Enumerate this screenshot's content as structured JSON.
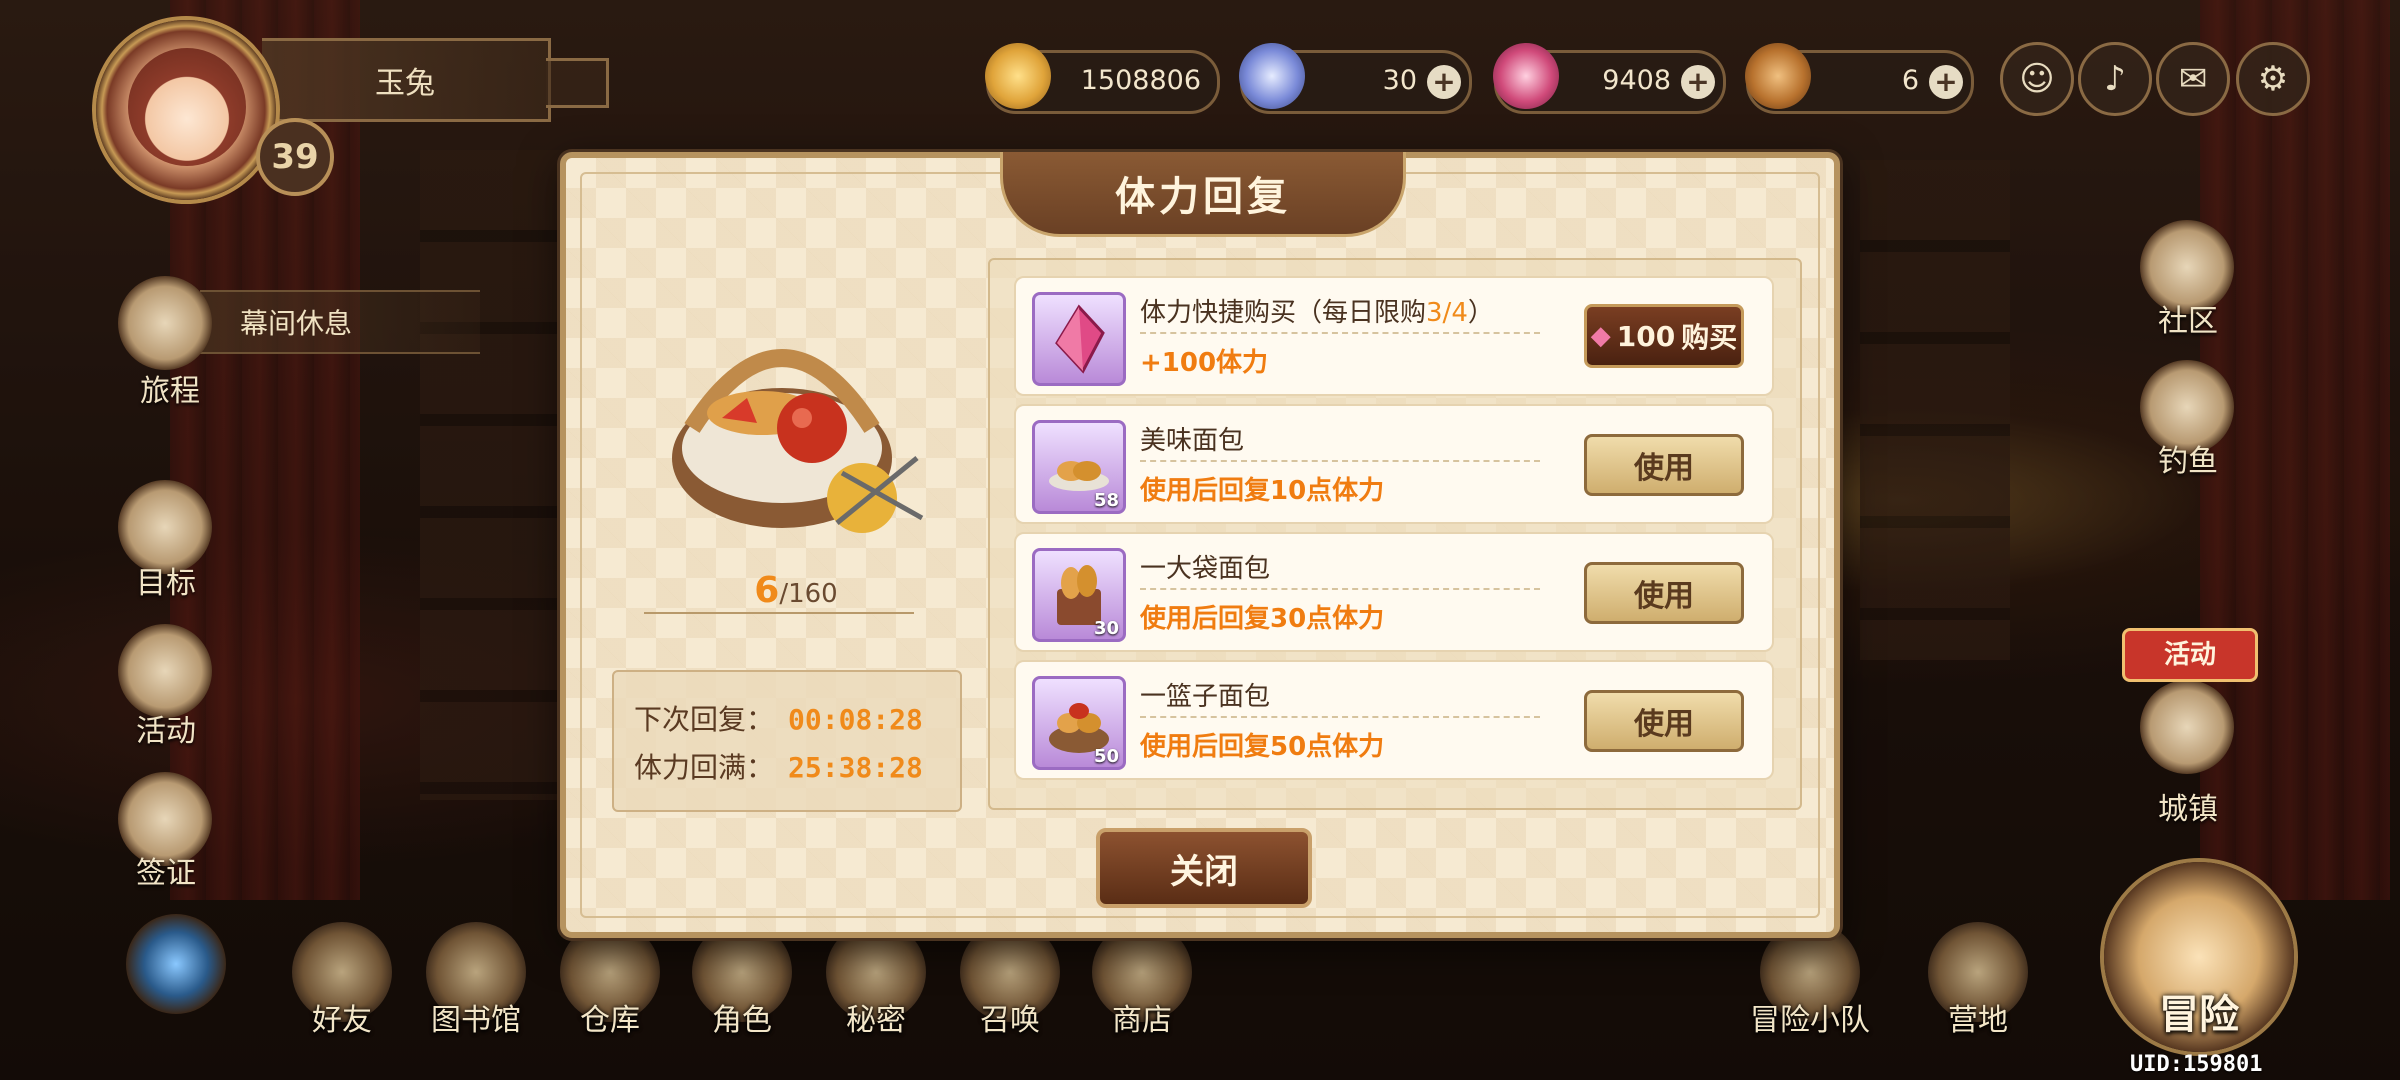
{
  "player": {
    "name": "玉兔",
    "level": "39"
  },
  "currencies": [
    {
      "id": "gold",
      "value": "1508806",
      "has_plus": false,
      "color": "#e0a43a"
    },
    {
      "id": "diamond",
      "value": "30",
      "has_plus": true,
      "color": "#7a8ad8"
    },
    {
      "id": "crystal",
      "value": "9408",
      "has_plus": true,
      "color": "#d04a7a"
    },
    {
      "id": "bread",
      "value": "6",
      "has_plus": true,
      "color": "#b8722e"
    }
  ],
  "plus_glyph": "+",
  "left_nav": {
    "journey": "旅程",
    "journey_plate": "幕间休息",
    "goal": "目标",
    "activity": "活动",
    "passport": "签证"
  },
  "right_nav": {
    "community": "社区",
    "fishing": "钓鱼",
    "event_badge": "活动",
    "town": "城镇"
  },
  "bottom_nav": [
    "好友",
    "图书馆",
    "仓库",
    "角色",
    "秘密",
    "召唤",
    "商店",
    "冒险小队",
    "营地"
  ],
  "adventure": "冒险",
  "uid": "UID:159801",
  "modal": {
    "title": "体力回复",
    "stamina_current": "6",
    "stamina_max": "/160",
    "next_recover_label": "下次回复：",
    "next_recover_time": "00:08:28",
    "full_recover_label": "体力回满：",
    "full_recover_time": "25:38:28",
    "quick_buy": {
      "name_prefix": "体力快捷购买（每日限购",
      "limit": "3/4",
      "name_suffix": "）",
      "desc": "+100体力",
      "price": "100",
      "buy_label": "购买"
    },
    "items": [
      {
        "name": "美味面包",
        "desc": "使用后回复10点体力",
        "count": "58",
        "button": "使用"
      },
      {
        "name": "一大袋面包",
        "desc": "使用后回复30点体力",
        "count": "30",
        "button": "使用"
      },
      {
        "name": "一篮子面包",
        "desc": "使用后回复50点体力",
        "count": "50",
        "button": "使用"
      }
    ],
    "close_label": "关闭"
  }
}
